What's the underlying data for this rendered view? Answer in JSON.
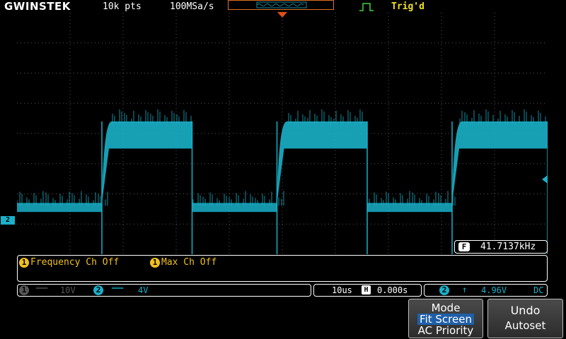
{
  "header": {
    "brand": "GWINSTEK",
    "record_length": "10k pts",
    "sample_rate": "100MSa/s",
    "trigger_status": "Trig'd"
  },
  "channel2_marker": "2",
  "frequency_readout": {
    "badge": "F",
    "value": "41.7137kHz"
  },
  "measurements": [
    {
      "index": "1",
      "text": "Frequency Ch Off"
    },
    {
      "index": "1",
      "text": "Max Ch Off"
    }
  ],
  "status": {
    "ch1": {
      "index": "1",
      "coupling_symbol": "═══",
      "scale": "10V"
    },
    "ch2": {
      "index": "2",
      "coupling_symbol": "═══",
      "scale": "4V"
    },
    "timebase": "10us",
    "position_badge": "H",
    "position": "0.000s",
    "trigger": {
      "index": "2",
      "slope_symbol": "↑",
      "level": "4.96V",
      "coupling": "DC"
    }
  },
  "softkeys": {
    "mode": {
      "title": "Mode",
      "selected": "Fit Screen",
      "other": "AC Priority"
    },
    "undo": {
      "title": "Undo",
      "subtitle": "Autoset"
    }
  },
  "colors": {
    "trace": "#19b0c8",
    "trigger_text": "#f0e020",
    "measure_text": "#f0c020",
    "trigger_marker": "#e05010",
    "selected_key_bg": "#1f5fa8"
  },
  "chart_data": {
    "type": "line",
    "title": "",
    "xlabel": "",
    "ylabel": "",
    "series": [
      {
        "description_of_shape": "square wave on channel 2",
        "rising_edges_div": [
          1.6,
          4.9,
          8.2
        ],
        "falling_edges_div": [
          3.3,
          6.6,
          10.0
        ],
        "high_level_div": [
          2.0,
          2.9
        ],
        "low_level_div": [
          -0.1,
          0.2
        ]
      }
    ],
    "x_divisions": 10,
    "y_divisions": 8,
    "grid": true
  }
}
